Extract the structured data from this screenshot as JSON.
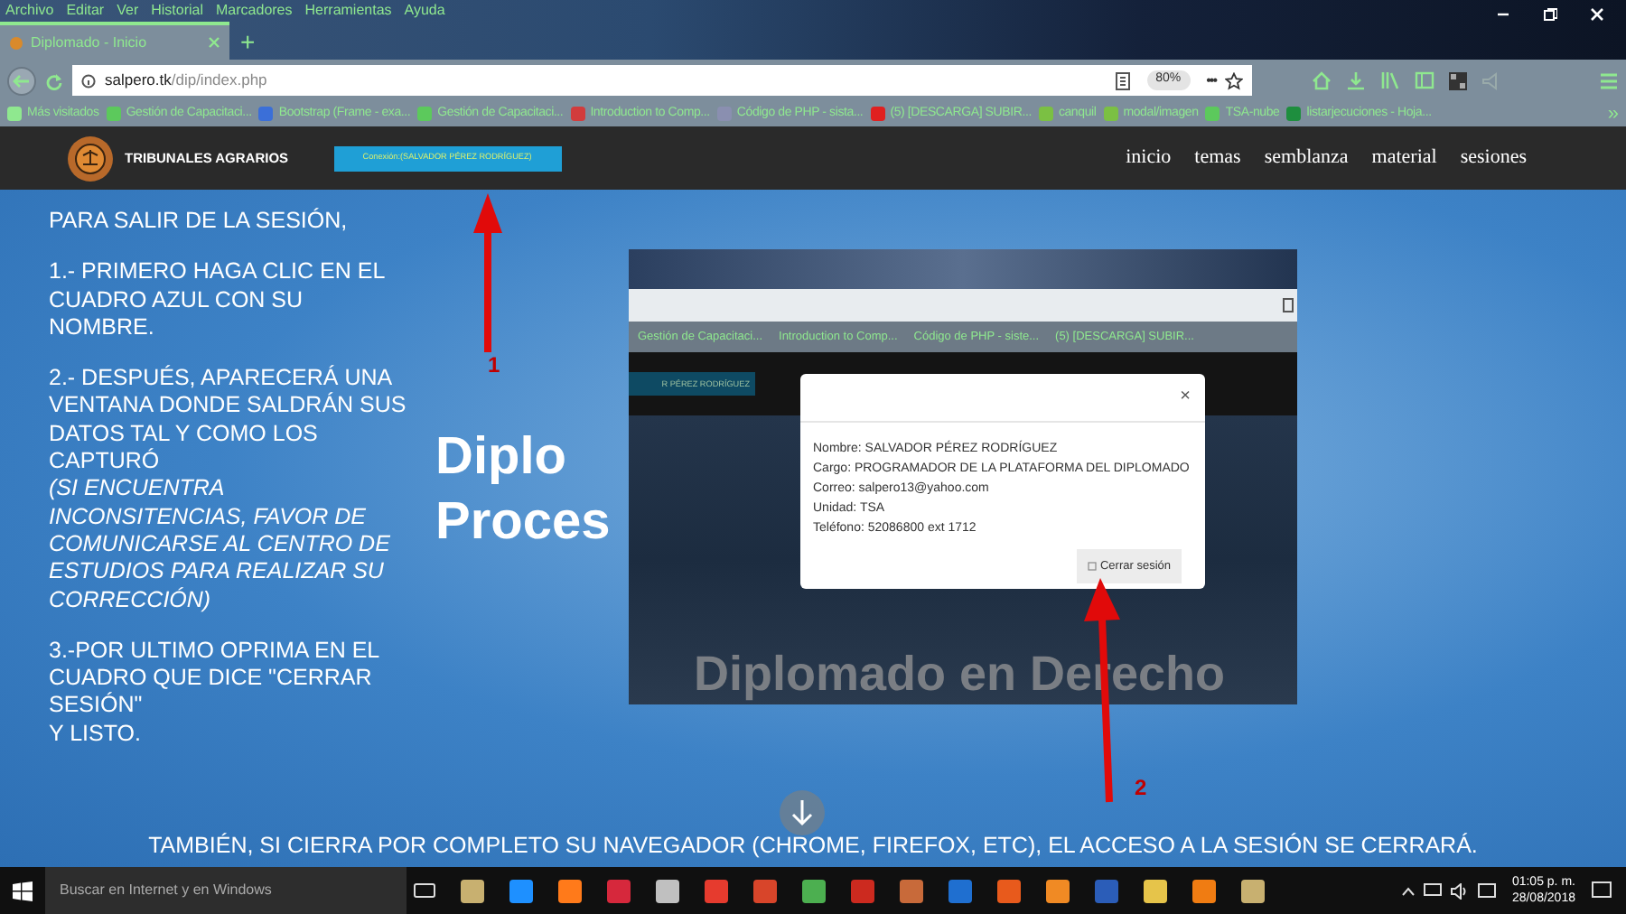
{
  "menu_bar": [
    "Archivo",
    "Editar",
    "Ver",
    "Historial",
    "Marcadores",
    "Herramientas",
    "Ayuda"
  ],
  "tabs": [
    {
      "label": "Diplomado - Inicio",
      "selected": true
    }
  ],
  "new_tab": "+",
  "address_bar": {
    "url_host": "salpero.tk",
    "url_path": "/dip/index.php",
    "zoom": "80%",
    "more": "•••"
  },
  "bookmarks": [
    {
      "label": "Más visitados",
      "color": "#8fe88f"
    },
    {
      "label": "Gestión de Capacitaci...",
      "color": "#5cc95c"
    },
    {
      "label": "Bootstrap (Frame - exa...",
      "color": "#3b6fd8"
    },
    {
      "label": "Gestión de Capacitaci...",
      "color": "#5cc95c"
    },
    {
      "label": "Introduction to Comp...",
      "color": "#d23c3c"
    },
    {
      "label": "Código de PHP - sista...",
      "color": "#8a8fb0"
    },
    {
      "label": "(5) [DESCARGA] SUBIR...",
      "color": "#e02020"
    },
    {
      "label": "canquil",
      "color": "#7bc043"
    },
    {
      "label": "modal/imagen",
      "color": "#7bc043"
    },
    {
      "label": "TSA-nube",
      "color": "#5cc95c"
    },
    {
      "label": "listarjecuciones - Hoja...",
      "color": "#1e8e3e"
    }
  ],
  "bookmarks_overflow": "»",
  "site": {
    "brand": "TRIBUNALES AGRARIOS",
    "session_button": "Conexión:(SALVADOR PÉREZ RODRÍGUEZ)",
    "nav": [
      "inicio",
      "temas",
      "semblanza",
      "material",
      "sesiones"
    ]
  },
  "instructions": [
    "PARA SALIR DE LA SESIÓN,",
    "1.- PRIMERO HAGA CLIC EN EL CUADRO AZUL CON SU NOMBRE.",
    "2.- DESPUÉS, APARECERÁ UNA VENTANA DONDE SALDRÁN SUS DATOS TAL Y COMO LOS CAPTURÓ\n*(SI ENCUENTRA INCONSITENCIAS, FAVOR DE COMUNICARSE AL CENTRO DE ESTUDIOS PARA REALIZAR SU CORRECCIÓN)*",
    "3.-POR ULTIMO OPRIMA EN EL CUADRO QUE DICE \"CERRAR SESIÓN\"\nY LISTO."
  ],
  "hero_title_lines": [
    "Diplo",
    "Proces"
  ],
  "screenshot": {
    "bookmarks": [
      "Gestión de Capacitaci...",
      "Introduction to Comp...",
      "Código de PHP - siste...",
      "(5) [DESCARGA] SUBIR..."
    ],
    "session_button_fragment": "R PÉREZ RODRÍGUEZ",
    "modal": {
      "close": "×",
      "fields": [
        "Nombre: SALVADOR PÉREZ RODRÍGUEZ",
        "Cargo: PROGRAMADOR DE LA PLATAFORMA DEL DIPLOMADO",
        "Correo: salpero13@yahoo.com",
        "Unidad: TSA",
        "Teléfono: 52086800 ext 1712"
      ],
      "button": "Cerrar sesión"
    },
    "background_title": "Diplomado en Derecho"
  },
  "arrow_labels": [
    "1",
    "2"
  ],
  "footer_note": "TAMBIÉN, SI CIERRA POR COMPLETO SU NAVEGADOR (CHROME, FIREFOX, ETC), EL ACCESO A LA SESIÓN SE CERRARÁ.",
  "taskbar": {
    "search_placeholder": "Buscar en Internet y en Windows",
    "time": "01:05 p. m.",
    "date": "28/08/2018",
    "apps": [
      {
        "color": "#c8b070"
      },
      {
        "color": "#1e90ff"
      },
      {
        "color": "#ff7a1a"
      },
      {
        "color": "#d6283c"
      },
      {
        "color": "#c0c0c0"
      },
      {
        "color": "#e63b2e"
      },
      {
        "color": "#d8452a"
      },
      {
        "color": "#4caf50"
      },
      {
        "color": "#cc2a1f"
      },
      {
        "color": "#c86a3a"
      },
      {
        "color": "#1f6fd0"
      },
      {
        "color": "#e85a1c"
      },
      {
        "color": "#f08a24"
      },
      {
        "color": "#2b5db8"
      },
      {
        "color": "#e6c44a"
      },
      {
        "color": "#f07c12"
      },
      {
        "color": "#c8b070"
      }
    ]
  }
}
